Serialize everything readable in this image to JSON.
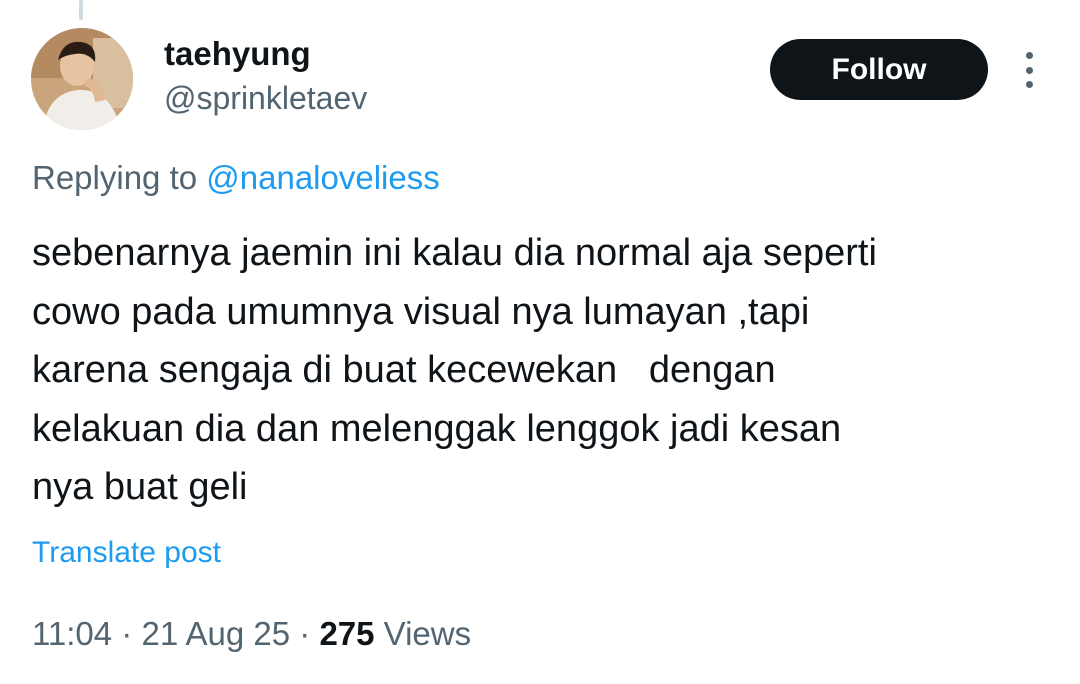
{
  "user": {
    "display_name": "taehyung",
    "handle": "@sprinkletaev"
  },
  "actions": {
    "follow_label": "Follow",
    "more_icon": "vertical-ellipsis-icon"
  },
  "reply": {
    "prefix": "Replying to ",
    "mention": "@nanaloveliess"
  },
  "tweet": {
    "lines": [
      "sebenarnya jaemin ini kalau dia normal aja seperti",
      "cowo pada umumnya visual nya lumayan ,tapi",
      "karena sengaja di buat kecewekan   dengan",
      "kelakuan dia dan melenggak lenggok jadi kesan",
      "nya buat geli"
    ]
  },
  "translate_label": "Translate post",
  "meta": {
    "time": "11:04",
    "separator": " · ",
    "date": "21 Aug 25",
    "views_count": "275",
    "views_label": " Views"
  },
  "colors": {
    "text_primary": "#0f1419",
    "text_secondary": "#536471",
    "link": "#1d9bf0",
    "button_bg": "#0f1419",
    "thread_line": "#cfd9de"
  }
}
